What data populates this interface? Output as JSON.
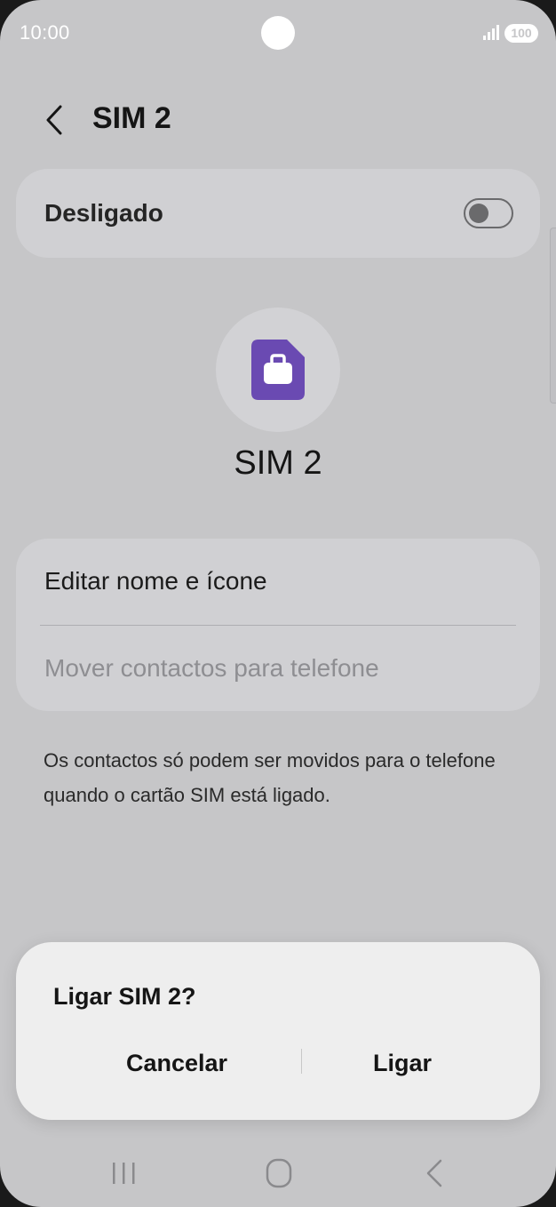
{
  "status_bar": {
    "time": "10:00",
    "battery": "100",
    "icons": [
      "camera-cutout",
      "signal-icon",
      "battery-icon"
    ]
  },
  "header": {
    "title": "SIM 2",
    "back_icon": "chevron-left-icon"
  },
  "toggle_card": {
    "label": "Desligado",
    "switch_on": false
  },
  "sim": {
    "icon": "sim-card-briefcase-icon",
    "icon_color": "#6a4ab2",
    "name": "SIM 2"
  },
  "options": {
    "edit_label": "Editar nome e ícone",
    "move_label": "Mover contactos para telefone"
  },
  "info_text": "Os contactos só podem ser movidos para o telefone quando o cartão SIM está ligado.",
  "dialog": {
    "title": "Ligar SIM 2?",
    "cancel_label": "Cancelar",
    "confirm_label": "Ligar"
  },
  "nav_bar": {
    "icons": [
      "recents-icon",
      "home-icon",
      "back-icon"
    ]
  },
  "colors": {
    "background": "#c6c6c8",
    "card": "#d0d0d3",
    "dialog": "#eeeeee",
    "accent": "#6a4ab2"
  }
}
